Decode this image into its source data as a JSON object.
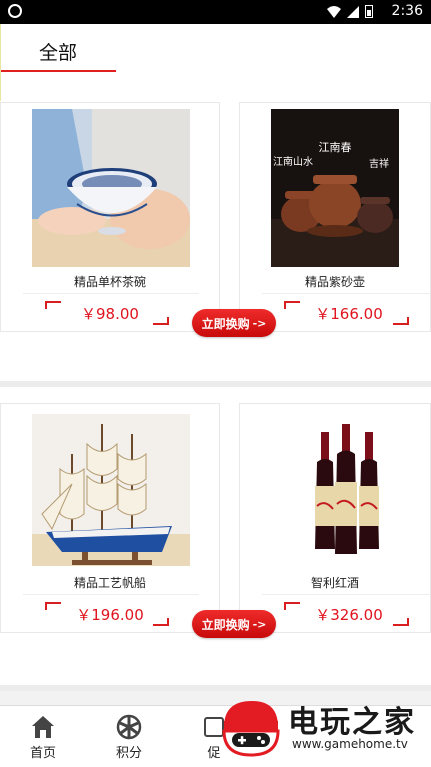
{
  "status_bar": {
    "time": "2:36"
  },
  "tabs": {
    "active": "全部"
  },
  "products": [
    {
      "name": "精品单杯茶碗",
      "price": "￥98.00"
    },
    {
      "name": "精品紫砂壶",
      "price": "￥166.00",
      "image_labels": [
        "江南春",
        "江南山水",
        "吉祥"
      ]
    },
    {
      "name": "精品工艺帆船",
      "price": "￥196.00"
    },
    {
      "name": "智利红酒",
      "price": "￥326.00"
    }
  ],
  "buy_button": {
    "label": "立即换购",
    "arrow": "->"
  },
  "bottom_nav": [
    {
      "label": "首页",
      "icon": "home-icon"
    },
    {
      "label": "积分",
      "icon": "points-wheel-icon"
    },
    {
      "label": "促",
      "icon": "promo-icon"
    }
  ],
  "watermark": {
    "title": "电玩之家",
    "url": "www.gamehome.tv"
  },
  "colors": {
    "accent": "#e0141e",
    "button": "#d81e1e"
  }
}
